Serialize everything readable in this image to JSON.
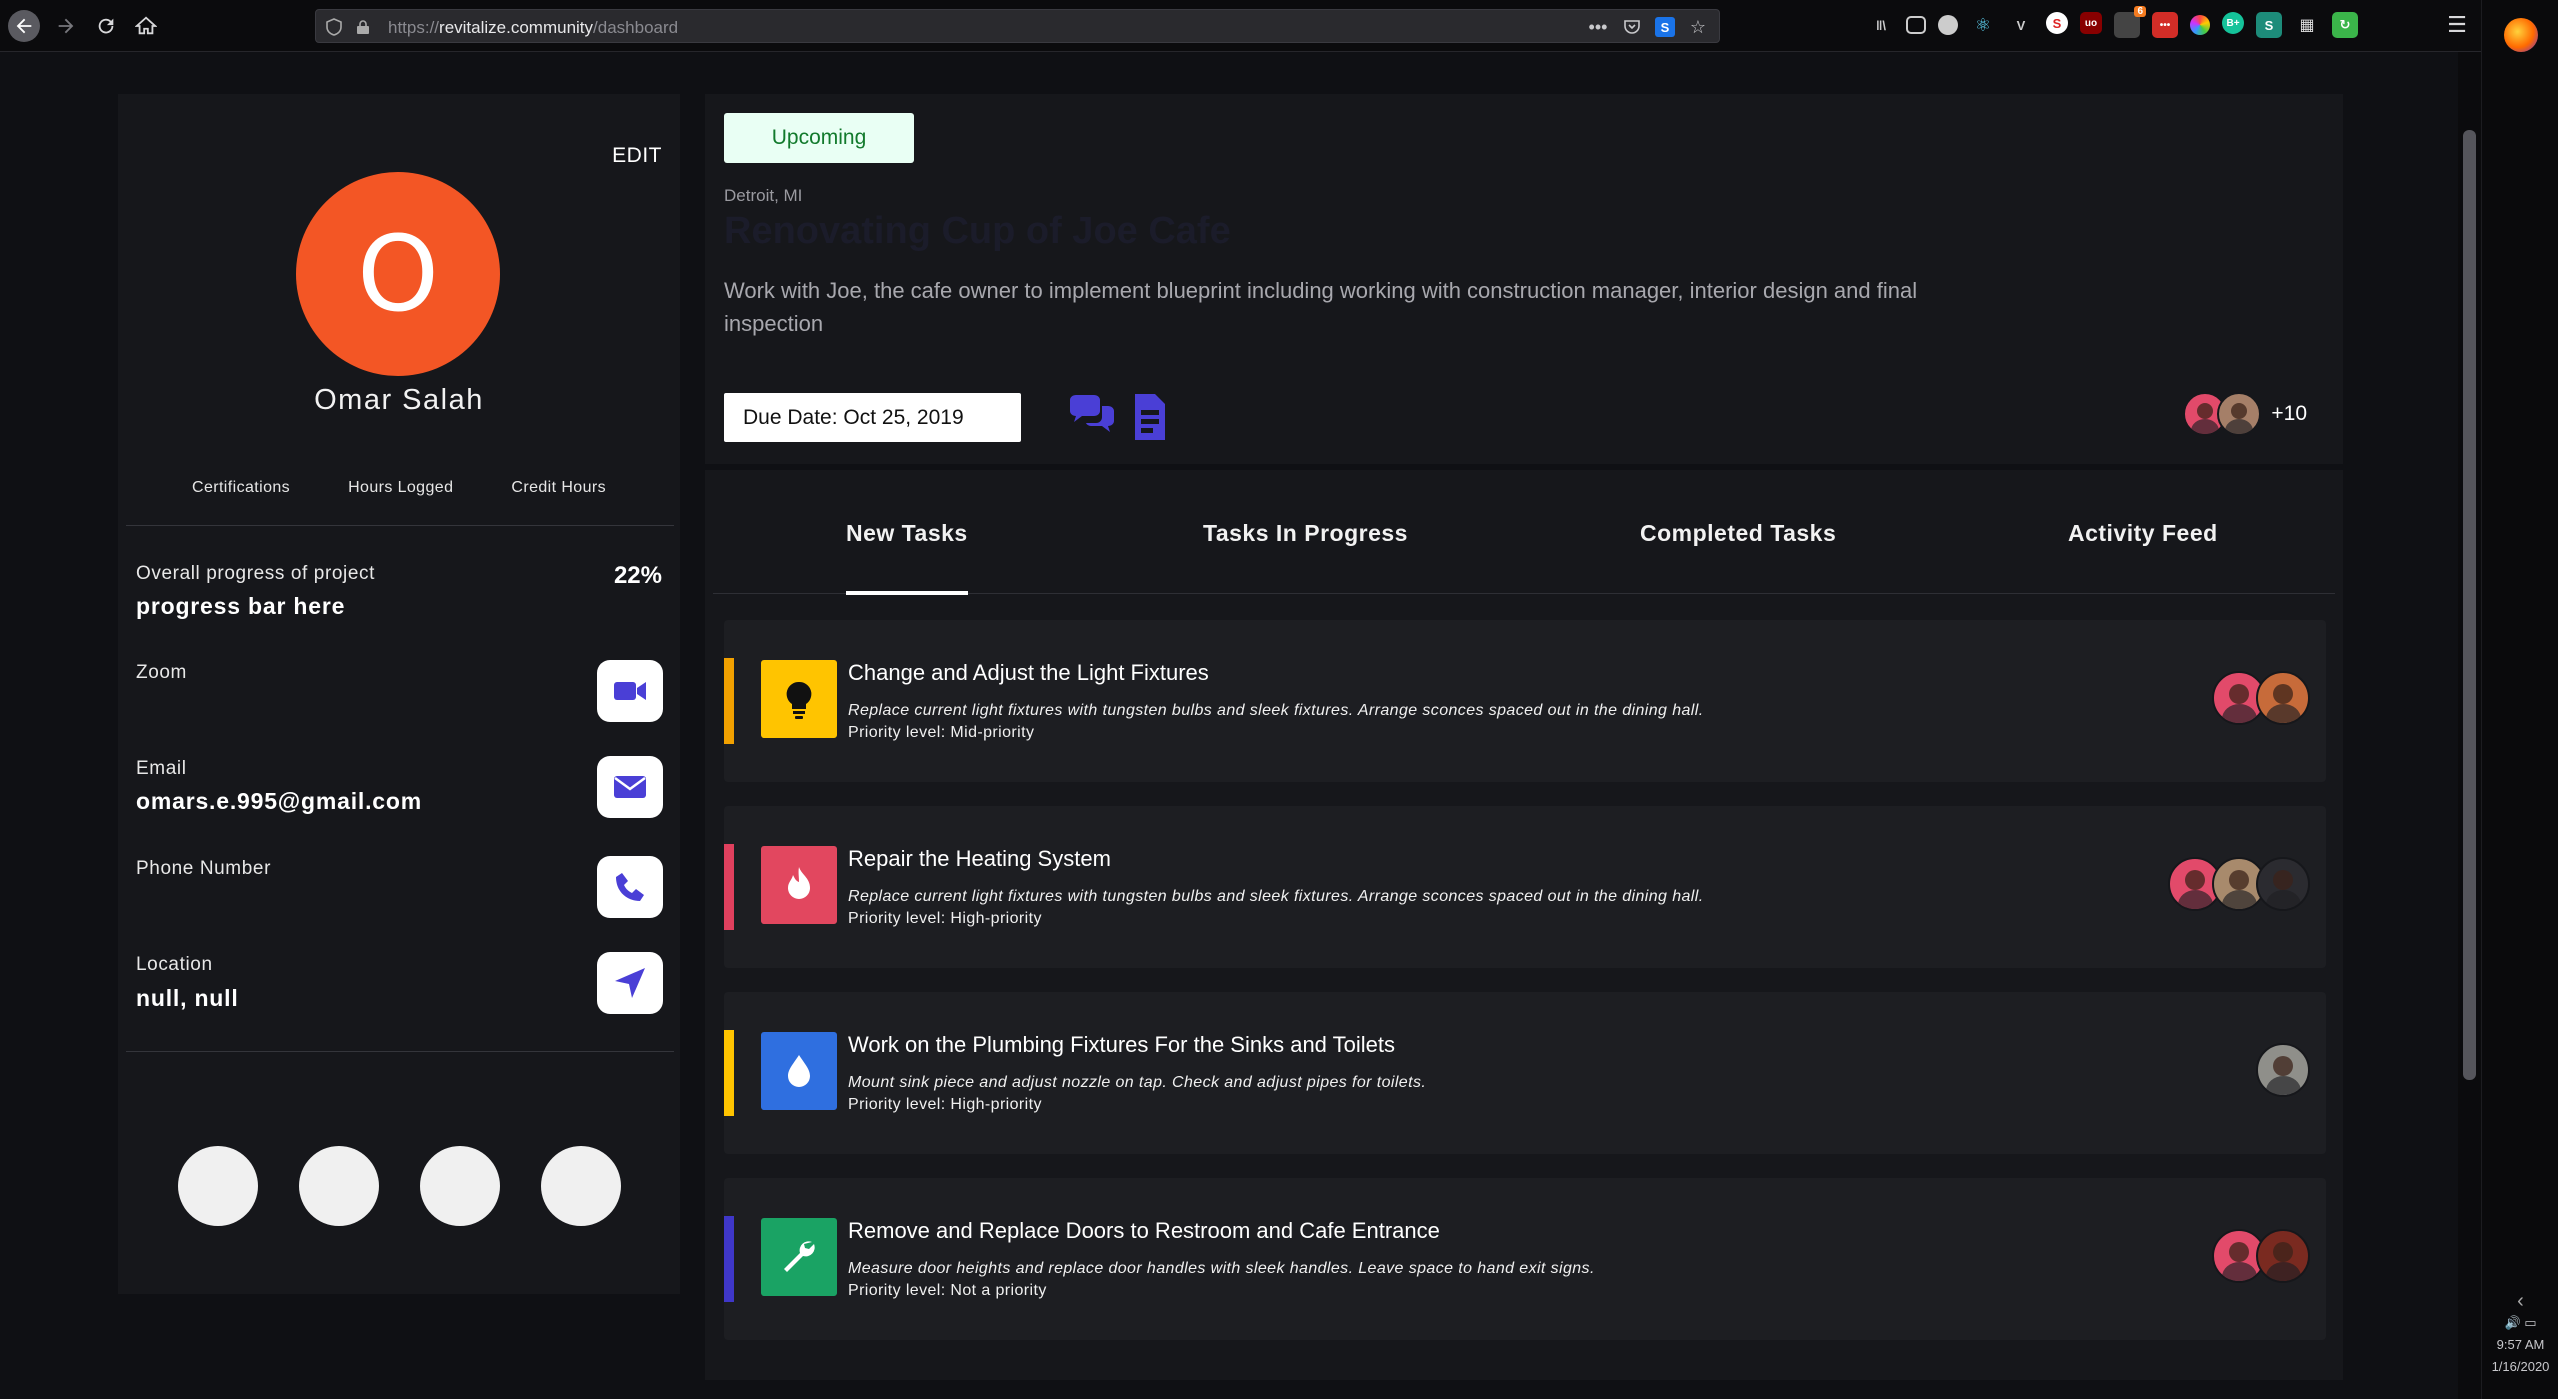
{
  "browser": {
    "url_prefix": "https://",
    "url_host": "revitalize.community",
    "url_path": "/dashboard",
    "ext_badge": "6"
  },
  "tray": {
    "time": "9:57 AM",
    "date": "1/16/2020"
  },
  "profile": {
    "edit_label": "EDIT",
    "avatar_initial": "O",
    "avatar_color": "#f35625",
    "name": "Omar Salah",
    "stats": [
      "Certifications",
      "Hours Logged",
      "Credit Hours"
    ],
    "progress_label": "Overall progress of project",
    "progress_value": "progress bar here",
    "progress_pct": "22%",
    "zoom_label": "Zoom",
    "email_label": "Email",
    "email_value": "omars.e.995@gmail.com",
    "phone_label": "Phone Number",
    "location_label": "Location",
    "location_value": "null, null"
  },
  "project": {
    "status": "Upcoming",
    "location": "Detroit, MI",
    "title": "Renovating Cup of Joe Cafe",
    "description": "Work with Joe, the cafe owner to implement blueprint including working with construction manager, interior design and final inspection",
    "due_date": "Due Date: Oct 25, 2019",
    "team_more": "+10",
    "accent_color": "#4a3fd6"
  },
  "tabs": [
    "New Tasks",
    "Tasks In Progress",
    "Completed Tasks",
    "Activity Feed"
  ],
  "tasks": [
    {
      "title": "Change and Adjust the Light Fixtures",
      "description": "Replace current light fixtures with tungsten bulbs and sleek fixtures. Arrange sconces spaced out in the dining hall.",
      "priority": "Priority level: Mid-priority",
      "accent": "#f2a100",
      "icon": "lightbulb-icon",
      "icon_bg": "#ffc400"
    },
    {
      "title": "Repair the Heating System",
      "description": "Replace current light fixtures with tungsten bulbs and sleek fixtures. Arrange sconces spaced out in the dining hall.",
      "priority": "Priority level: High-priority",
      "accent": "#e0405e",
      "icon": "fire-icon",
      "icon_bg": "#e2475f"
    },
    {
      "title": "Work on the Plumbing Fixtures For the Sinks and Toilets",
      "description": "Mount sink piece and adjust nozzle on tap. Check and adjust pipes for toilets.",
      "priority": "Priority level: High-priority",
      "accent": "#ffc400",
      "icon": "water-drop-icon",
      "icon_bg": "#2f6fe0"
    },
    {
      "title": "Remove and Replace Doors to Restroom and Cafe Entrance",
      "description": "Measure door heights and replace door handles with sleek handles. Leave space to hand exit signs.",
      "priority": "Priority level: Not a priority",
      "accent": "#3f37c9",
      "icon": "wrench-icon",
      "icon_bg": "#1aa364"
    }
  ]
}
